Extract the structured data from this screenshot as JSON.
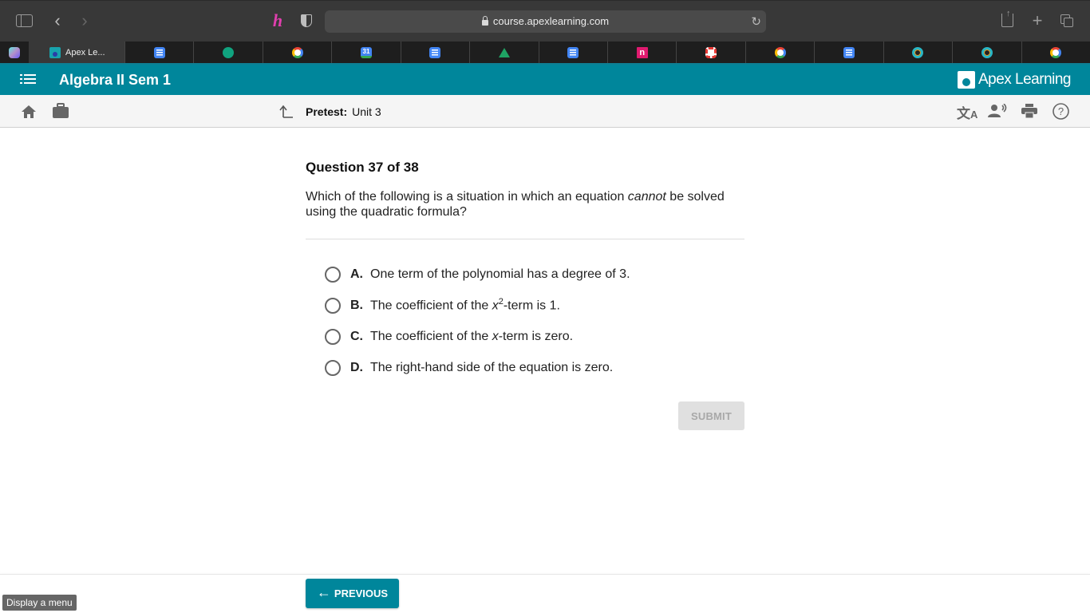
{
  "browser": {
    "url": "course.apexlearning.com",
    "tabs": [
      {
        "icon": "hex-extension-icon",
        "kind": "hex"
      },
      {
        "icon": "apex-learning-favicon",
        "kind": "apex",
        "title": "Apex Le...",
        "active": true
      },
      {
        "icon": "google-docs-icon",
        "kind": "docs"
      },
      {
        "icon": "chatgpt-icon",
        "kind": "gpt"
      },
      {
        "icon": "google-icon",
        "kind": "google"
      },
      {
        "icon": "google-calendar-icon",
        "kind": "cal",
        "glyph": "31"
      },
      {
        "icon": "google-docs-icon",
        "kind": "docs"
      },
      {
        "icon": "google-drive-icon",
        "kind": "drive"
      },
      {
        "icon": "google-docs-icon",
        "kind": "docs"
      },
      {
        "icon": "n-app-icon",
        "kind": "n",
        "glyph": "n"
      },
      {
        "icon": "red-ring-icon",
        "kind": "ring"
      },
      {
        "icon": "google-icon",
        "kind": "google"
      },
      {
        "icon": "google-docs-icon",
        "kind": "docs"
      },
      {
        "icon": "quiz-app-icon",
        "kind": "quiz"
      },
      {
        "icon": "quiz-app-icon",
        "kind": "quiz"
      },
      {
        "icon": "google-icon",
        "kind": "google"
      }
    ]
  },
  "app": {
    "course_title": "Algebra II Sem 1",
    "brand": "Apex Learning",
    "activity_label": "Pretest:",
    "activity_name": "Unit 3"
  },
  "question": {
    "number_label": "Question 37 of 38",
    "prompt_before": "Which of the following is a situation in which an equation ",
    "prompt_emphasis": "cannot",
    "prompt_after": " be solved using the quadratic formula?",
    "answers": [
      {
        "letter": "A.",
        "parts": [
          {
            "t": "One term of the polynomial has a degree of 3."
          }
        ]
      },
      {
        "letter": "B.",
        "parts": [
          {
            "t": "The coefficient of the "
          },
          {
            "t": "x",
            "i": true
          },
          {
            "t": "2",
            "sup": true
          },
          {
            "t": "-term is 1."
          }
        ]
      },
      {
        "letter": "C.",
        "parts": [
          {
            "t": "The coefficient of the "
          },
          {
            "t": "x",
            "i": true
          },
          {
            "t": "-term is zero."
          }
        ]
      },
      {
        "letter": "D.",
        "parts": [
          {
            "t": "The right-hand side of the equation is zero."
          }
        ]
      }
    ],
    "selected": null,
    "submit_label": "SUBMIT"
  },
  "footer": {
    "previous_label": "PREVIOUS",
    "tooltip": "Display a menu"
  }
}
